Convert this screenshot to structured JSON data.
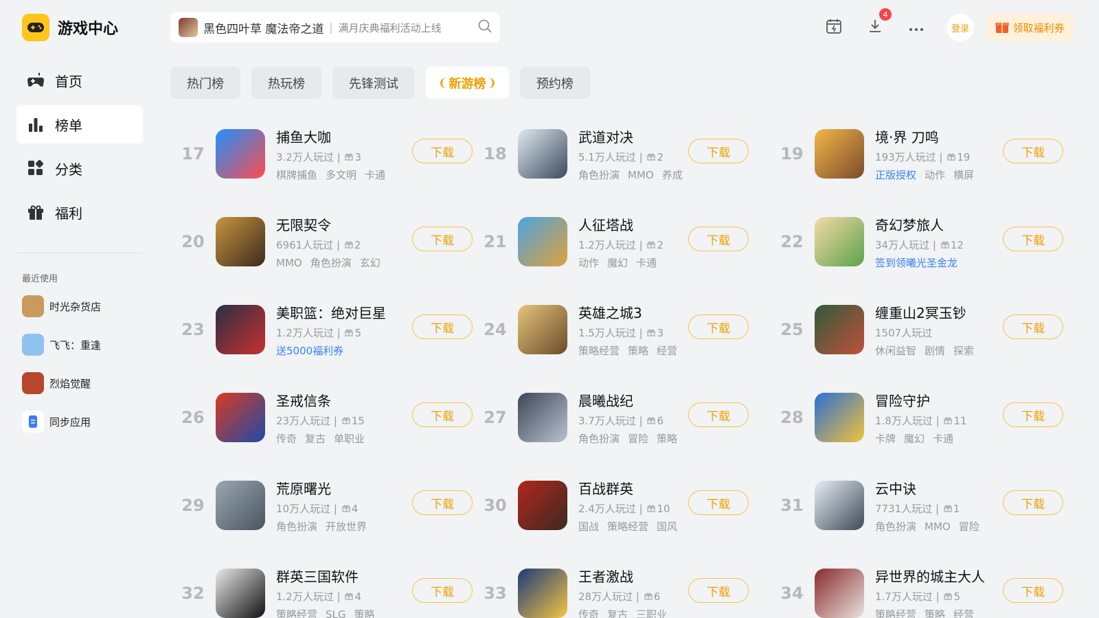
{
  "app": {
    "title": "游戏中心",
    "accent": "#ffc51a"
  },
  "sidebar": {
    "items": [
      {
        "label": "首页",
        "icon": "gamepad-icon"
      },
      {
        "label": "榜单",
        "icon": "bar-chart-icon"
      },
      {
        "label": "分类",
        "icon": "category-icon"
      },
      {
        "label": "福利",
        "icon": "gift-icon"
      }
    ],
    "recent_title": "最近使用",
    "recent": [
      {
        "label": "时光杂货店",
        "color": "#c89a5b"
      },
      {
        "label": "飞飞：重逢",
        "color": "#8fc3ef"
      },
      {
        "label": "烈焰觉醒",
        "color": "#b8462a"
      },
      {
        "label": "同步应用",
        "color": "#3b7bf6"
      }
    ]
  },
  "search": {
    "value": "黑色四叶草 魔法帝之道",
    "hint": "满月庆典福利活动上线"
  },
  "header": {
    "download_badge": "4",
    "login_label": "登录",
    "coupon_label": "领取福利券"
  },
  "tabs": [
    {
      "label": "热门榜"
    },
    {
      "label": "热玩榜"
    },
    {
      "label": "先锋测试"
    },
    {
      "label": "新游榜"
    },
    {
      "label": "预约榜"
    }
  ],
  "download_label": "下载",
  "games": [
    {
      "rank": "17",
      "name": "捕鱼大咖",
      "stats": "3.2万人玩过 | ",
      "gifts": "3",
      "tags": [
        "棋牌捕鱼",
        "多文明",
        "卡通"
      ],
      "promo": "",
      "colors": [
        "#1e90ff",
        "#ff4d4d"
      ]
    },
    {
      "rank": "18",
      "name": "武道对决",
      "stats": "5.1万人玩过 | ",
      "gifts": "2",
      "tags": [
        "角色扮演",
        "MMO",
        "养成"
      ],
      "promo": "",
      "colors": [
        "#dfe9f2",
        "#3d4a5c"
      ]
    },
    {
      "rank": "19",
      "name": "境·界 刀鸣",
      "stats": "193万人玩过 | ",
      "gifts": "19",
      "tags": [
        "动作",
        "横屏"
      ],
      "promo": "正版授权",
      "colors": [
        "#f4b64a",
        "#7b4b2a"
      ]
    },
    {
      "rank": "20",
      "name": "无限契令",
      "stats": "6961人玩过 | ",
      "gifts": "2",
      "tags": [
        "MMO",
        "角色扮演",
        "玄幻"
      ],
      "promo": "",
      "colors": [
        "#c9953f",
        "#3b2a1d"
      ]
    },
    {
      "rank": "21",
      "name": "人征塔战",
      "stats": "1.2万人玩过 | ",
      "gifts": "2",
      "tags": [
        "动作",
        "魔幻",
        "卡通"
      ],
      "promo": "",
      "colors": [
        "#4aa3e0",
        "#e0a23a"
      ]
    },
    {
      "rank": "22",
      "name": "奇幻梦旅人",
      "stats": "34万人玩过 | ",
      "gifts": "12",
      "tags": [],
      "promo": "签到领曦光圣金龙",
      "colors": [
        "#f7d9a8",
        "#5aa34a"
      ]
    },
    {
      "rank": "23",
      "name": "美职篮：绝对巨星",
      "stats": "1.2万人玩过 | ",
      "gifts": "5",
      "tags": [],
      "promo": "送5000福利券",
      "colors": [
        "#2a2f45",
        "#c7302f"
      ]
    },
    {
      "rank": "24",
      "name": "英雄之城3",
      "stats": "1.5万人玩过 | ",
      "gifts": "3",
      "tags": [
        "策略经营",
        "策略",
        "经营"
      ],
      "promo": "",
      "colors": [
        "#e5c57a",
        "#6b4a2a"
      ]
    },
    {
      "rank": "25",
      "name": "缠重山2冥玉钞",
      "stats": "1507人玩过",
      "gifts": "",
      "tags": [
        "休闲益智",
        "剧情",
        "探索"
      ],
      "promo": "",
      "colors": [
        "#2f5a3a",
        "#c0513a"
      ]
    },
    {
      "rank": "26",
      "name": "圣戒信条",
      "stats": "23万人玩过 | ",
      "gifts": "15",
      "tags": [
        "传奇",
        "复古",
        "单职业"
      ],
      "promo": "",
      "colors": [
        "#d93b1f",
        "#1e4aa8"
      ]
    },
    {
      "rank": "27",
      "name": "晨曦战纪",
      "stats": "3.7万人玩过 | ",
      "gifts": "6",
      "tags": [
        "角色扮演",
        "冒险",
        "策略"
      ],
      "promo": "",
      "colors": [
        "#3c4656",
        "#b9c2cf"
      ]
    },
    {
      "rank": "28",
      "name": "冒险守护",
      "stats": "1.8万人玩过 | ",
      "gifts": "11",
      "tags": [
        "卡牌",
        "魔幻",
        "卡通"
      ],
      "promo": "",
      "colors": [
        "#2a6fd6",
        "#f2c23a"
      ]
    },
    {
      "rank": "29",
      "name": "荒原曙光",
      "stats": "10万人玩过 | ",
      "gifts": "4",
      "tags": [
        "角色扮演",
        "开放世界"
      ],
      "promo": "",
      "colors": [
        "#9aa6b3",
        "#4a5560"
      ]
    },
    {
      "rank": "30",
      "name": "百战群英",
      "stats": "2.4万人玩过 | ",
      "gifts": "10",
      "tags": [
        "国战",
        "策略经营",
        "国风"
      ],
      "promo": "",
      "colors": [
        "#b3261e",
        "#3a2a20"
      ]
    },
    {
      "rank": "31",
      "name": "云中诀",
      "stats": "7731人玩过 | ",
      "gifts": "1",
      "tags": [
        "角色扮演",
        "MMO",
        "冒险"
      ],
      "promo": "",
      "colors": [
        "#e7eef5",
        "#3e4a58"
      ]
    },
    {
      "rank": "32",
      "name": "群英三国软件",
      "stats": "1.2万人玩过 | ",
      "gifts": "4",
      "tags": [
        "策略经营",
        "SLG",
        "策略"
      ],
      "promo": "",
      "colors": [
        "#eaeaea",
        "#111111"
      ]
    },
    {
      "rank": "33",
      "name": "王者激战",
      "stats": "28万人玩过 | ",
      "gifts": "6",
      "tags": [
        "传奇",
        "复古",
        "三职业"
      ],
      "promo": "",
      "colors": [
        "#1d3a7a",
        "#f5c542"
      ]
    },
    {
      "rank": "34",
      "name": "异世界的城主大人",
      "stats": "1.7万人玩过 | ",
      "gifts": "5",
      "tags": [
        "策略经营",
        "策略",
        "经营"
      ],
      "promo": "",
      "colors": [
        "#8a2a2a",
        "#e8e2e0"
      ]
    }
  ]
}
